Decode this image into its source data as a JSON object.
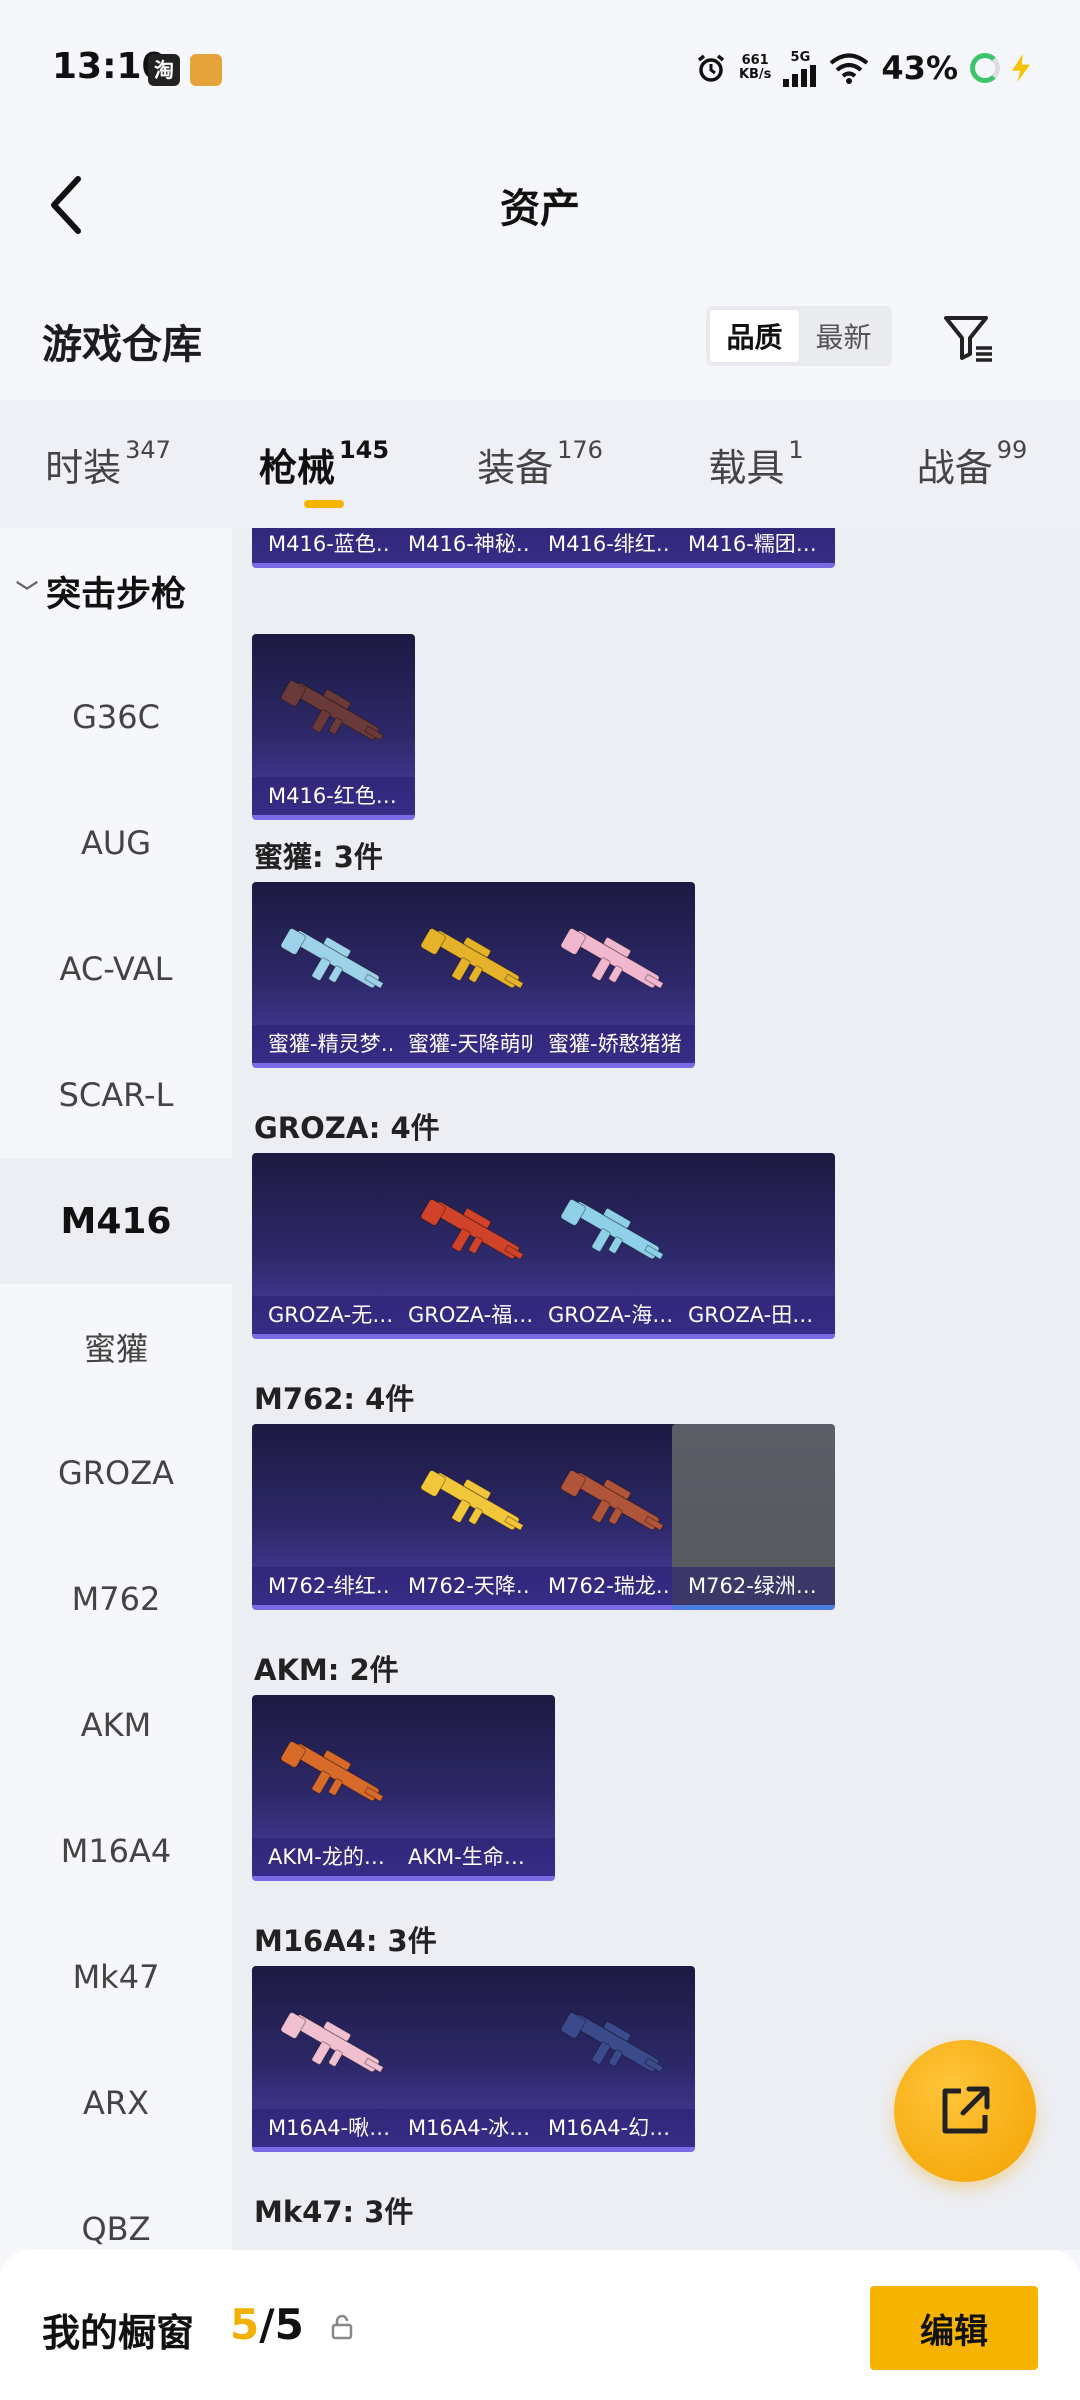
{
  "status_bar": {
    "time": "13:10",
    "app_icons": [
      "淘",
      "app"
    ],
    "net_speed_value": "661",
    "net_speed_unit": "KB/s",
    "network": "5G",
    "battery": "43%"
  },
  "appbar": {
    "title": "资产"
  },
  "warehouse": {
    "title": "游戏仓库",
    "sort_options": [
      "品质",
      "最新"
    ],
    "sort_selected": "品质"
  },
  "tabs": [
    {
      "label": "时装",
      "count": "347",
      "active": false
    },
    {
      "label": "枪械",
      "count": "145",
      "active": true
    },
    {
      "label": "装备",
      "count": "176",
      "active": false
    },
    {
      "label": "载具",
      "count": "1",
      "active": false
    },
    {
      "label": "战备",
      "count": "99",
      "active": false
    }
  ],
  "sidebar": {
    "group": "突击步枪",
    "items": [
      "G36C",
      "AUG",
      "AC-VAL",
      "SCAR-L",
      "M416",
      "蜜獾",
      "GROZA",
      "M762",
      "AKM",
      "M16A4",
      "Mk47",
      "ARX",
      "QBZ"
    ],
    "active": "M416"
  },
  "sections": [
    {
      "heading": "",
      "items": [
        {
          "label": "M416-蓝色…",
          "gun": "none"
        },
        {
          "label": "M416-神秘…",
          "gun": "none"
        },
        {
          "label": "M416-绯红…",
          "gun": "none"
        },
        {
          "label": "M416-糯团…",
          "gun": "none"
        }
      ]
    },
    {
      "heading": "",
      "items": [
        {
          "label": "M416-红色…",
          "gun": "#6a3a3a"
        }
      ]
    },
    {
      "heading": "蜜獾: 3件",
      "items": [
        {
          "label": "蜜獾-精灵梦…",
          "gun": "#9ed2ea"
        },
        {
          "label": "蜜獾-天降萌叽",
          "gun": "#e6b22a"
        },
        {
          "label": "蜜獾-娇憨猪猪",
          "gun": "#f1b7cf"
        }
      ]
    },
    {
      "heading": "GROZA: 4件",
      "items": [
        {
          "label": "GROZA-无…",
          "gun": "none"
        },
        {
          "label": "GROZA-福…",
          "gun": "#d0432a"
        },
        {
          "label": "GROZA-海…",
          "gun": "#8ed0e8"
        },
        {
          "label": "GROZA-田…",
          "gun": "none"
        }
      ]
    },
    {
      "heading": "M762: 4件",
      "items": [
        {
          "label": "M762-绯红…",
          "gun": "none"
        },
        {
          "label": "M762-天降…",
          "gun": "#f2c63a"
        },
        {
          "label": "M762-瑞龙…",
          "gun": "#b0553a"
        },
        {
          "label": "M762-绿洲…",
          "gun": "none",
          "grey": true
        }
      ]
    },
    {
      "heading": "AKM: 2件",
      "items": [
        {
          "label": "AKM-龙的…",
          "gun": "#d86a2a"
        },
        {
          "label": "AKM-生命…",
          "gun": "none"
        }
      ]
    },
    {
      "heading": "M16A4: 3件",
      "items": [
        {
          "label": "M16A4-啾…",
          "gun": "#f0c0d0"
        },
        {
          "label": "M16A4-冰…",
          "gun": "none"
        },
        {
          "label": "M16A4-幻…",
          "gun": "#3a4a8a"
        }
      ]
    },
    {
      "heading": "Mk47: 3件",
      "items": []
    }
  ],
  "bottom": {
    "title": "我的橱窗",
    "used": "5",
    "separator": "/",
    "total": "5",
    "edit_label": "编辑"
  },
  "colors": {
    "accent": "#f6b400",
    "card_bottom": "#4c3fa6"
  }
}
